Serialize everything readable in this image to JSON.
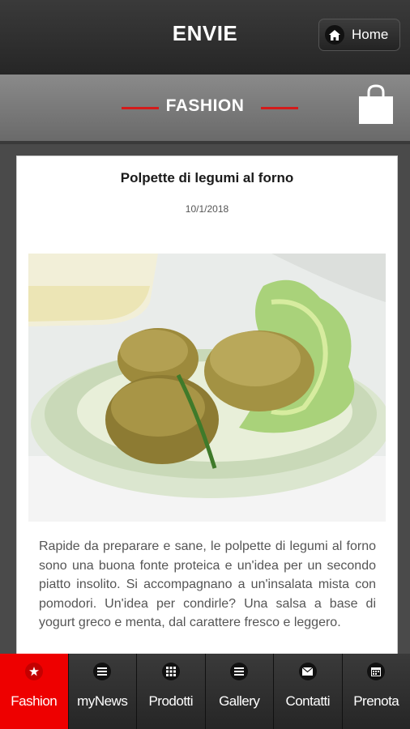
{
  "header": {
    "title": "ENVIE",
    "home_label": "Home"
  },
  "section": {
    "title": "FASHION"
  },
  "post": {
    "title": "Polpette di legumi al forno",
    "date": "10/1/2018",
    "body": "Rapide da preparare e sane, le polpette di legumi al forno sono una buona fonte proteica e un'idea per un secondo piatto insolito. Si accompagnano a un'insalata mista con pomodori. Un'idea per condirle? Una salsa a base di yogurt greco e menta, dal carattere fresco e leggero."
  },
  "nav": {
    "items": [
      {
        "label": "Fashion",
        "icon": "star-icon",
        "active": true
      },
      {
        "label": "myNews",
        "icon": "list-icon",
        "active": false
      },
      {
        "label": "Prodotti",
        "icon": "grid-icon",
        "active": false
      },
      {
        "label": "Gallery",
        "icon": "list-icon",
        "active": false
      },
      {
        "label": "Contatti",
        "icon": "mail-icon",
        "active": false
      },
      {
        "label": "Prenota",
        "icon": "calendar-icon",
        "active": false
      }
    ]
  },
  "colors": {
    "accent": "#ee0000",
    "section_line": "#d41b1b"
  }
}
